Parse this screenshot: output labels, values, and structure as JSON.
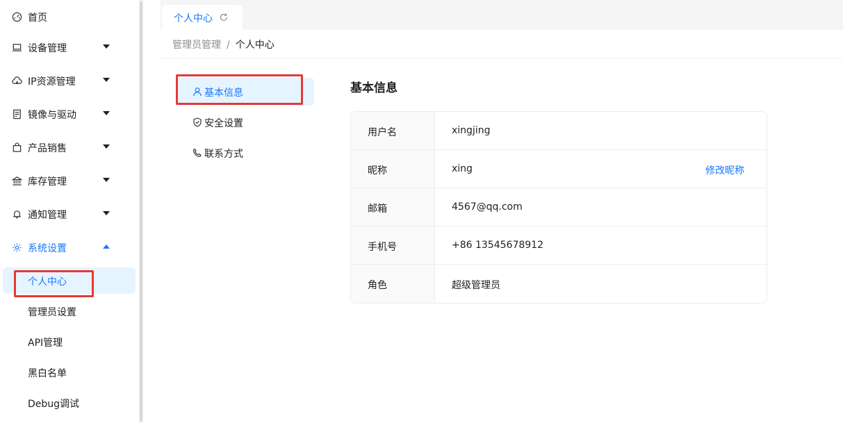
{
  "sidebar": {
    "items": [
      {
        "label": "首页",
        "icon": "dashboard-icon"
      },
      {
        "label": "设备管理",
        "icon": "laptop-icon"
      },
      {
        "label": "IP资源管理",
        "icon": "cloud-icon"
      },
      {
        "label": "镜像与驱动",
        "icon": "file-image-icon"
      },
      {
        "label": "产品销售",
        "icon": "shopping-bag-icon"
      },
      {
        "label": "库存管理",
        "icon": "bank-icon"
      },
      {
        "label": "通知管理",
        "icon": "bell-icon"
      },
      {
        "label": "系统设置",
        "icon": "gear-icon"
      }
    ],
    "subitems": [
      {
        "label": "个人中心"
      },
      {
        "label": "管理员设置"
      },
      {
        "label": "API管理"
      },
      {
        "label": "黑白名单"
      },
      {
        "label": "Debug调试"
      }
    ]
  },
  "tabs": [
    {
      "label": "个人中心"
    }
  ],
  "breadcrumb": {
    "parent": "管理员管理",
    "separator": "/",
    "current": "个人中心"
  },
  "profile_menu": [
    {
      "label": "基本信息",
      "icon": "user-icon"
    },
    {
      "label": "安全设置",
      "icon": "shield-icon"
    },
    {
      "label": "联系方式",
      "icon": "phone-icon"
    }
  ],
  "basic_info": {
    "title": "基本信息",
    "rows": [
      {
        "key": "用户名",
        "value": "xingjing"
      },
      {
        "key": "昵称",
        "value": "xing",
        "action": "修改昵称"
      },
      {
        "key": "邮箱",
        "value": "4567@qq.com"
      },
      {
        "key": "手机号",
        "value": "+86 13545678912"
      },
      {
        "key": "角色",
        "value": "超级管理员"
      }
    ]
  },
  "colors": {
    "accent": "#1677ff",
    "selected_bg": "#e6f4ff",
    "highlight_border": "#e53935"
  }
}
